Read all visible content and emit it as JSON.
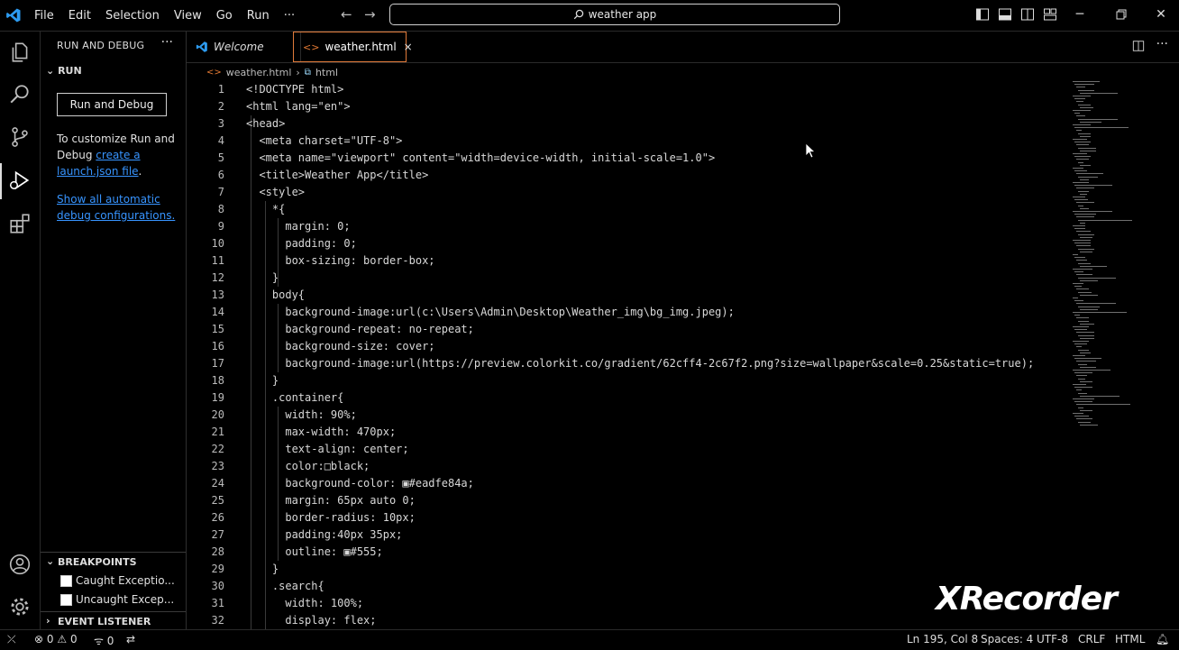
{
  "titlebar": {
    "menu": [
      "File",
      "Edit",
      "Selection",
      "View",
      "Go",
      "Run",
      "···"
    ],
    "search_text": "weather app"
  },
  "sidebar": {
    "title": "RUN AND DEBUG",
    "more": "···",
    "section_run": "RUN",
    "run_button": "Run and Debug",
    "customize_text_1": "To customize Run and Debug",
    "customize_link": "create a launch.json file",
    "customize_text_2": ".",
    "show_all_link": "Show all automatic debug configurations.",
    "breakpoints_header": "BREAKPOINTS",
    "breakpoints": [
      "Caught Exceptio...",
      "Uncaught Excep..."
    ],
    "event_listener_header": "EVENT LISTENER BREAKP..."
  },
  "tabs": [
    {
      "label": "Welcome",
      "active": false
    },
    {
      "label": "weather.html",
      "active": true,
      "close": "×"
    }
  ],
  "breadcrumb": {
    "file": "weather.html",
    "element": "html"
  },
  "code": [
    {
      "n": "1",
      "t": "<!DOCTYPE html>"
    },
    {
      "n": "2",
      "t": "<html lang=\"en\">"
    },
    {
      "n": "3",
      "t": "<head>"
    },
    {
      "n": "4",
      "t": "  <meta charset=\"UTF-8\">"
    },
    {
      "n": "5",
      "t": "  <meta name=\"viewport\" content=\"width=device-width, initial-scale=1.0\">"
    },
    {
      "n": "6",
      "t": "  <title>Weather App</title>"
    },
    {
      "n": "7",
      "t": "  <style>"
    },
    {
      "n": "8",
      "t": "    *{"
    },
    {
      "n": "9",
      "t": "      margin: 0;"
    },
    {
      "n": "10",
      "t": "      padding: 0;"
    },
    {
      "n": "11",
      "t": "      box-sizing: border-box;"
    },
    {
      "n": "12",
      "t": "    }"
    },
    {
      "n": "13",
      "t": "    body{"
    },
    {
      "n": "14",
      "t": "      background-image:url(c:\\Users\\Admin\\Desktop\\Weather_img\\bg_img.jpeg);"
    },
    {
      "n": "15",
      "t": "      background-repeat: no-repeat;"
    },
    {
      "n": "16",
      "t": "      background-size: cover;"
    },
    {
      "n": "17",
      "t": "      background-image:url(https://preview.colorkit.co/gradient/62cff4-2c67f2.png?size=wallpaper&scale=0.25&static=true);"
    },
    {
      "n": "18",
      "t": "    }"
    },
    {
      "n": "19",
      "t": "    .container{"
    },
    {
      "n": "20",
      "t": "      width: 90%;"
    },
    {
      "n": "21",
      "t": "      max-width: 470px;"
    },
    {
      "n": "22",
      "t": "      text-align: center;"
    },
    {
      "n": "23",
      "t": "      color:□black;"
    },
    {
      "n": "24",
      "t": "      background-color: ▣#eadfe84a;"
    },
    {
      "n": "25",
      "t": "      margin: 65px auto 0;"
    },
    {
      "n": "26",
      "t": "      border-radius: 10px;"
    },
    {
      "n": "27",
      "t": "      padding:40px 35px;"
    },
    {
      "n": "28",
      "t": "      outline: ▣#555;"
    },
    {
      "n": "29",
      "t": "    }"
    },
    {
      "n": "30",
      "t": "    .search{"
    },
    {
      "n": "31",
      "t": "      width: 100%;"
    },
    {
      "n": "32",
      "t": "      display: flex;"
    }
  ],
  "watermark": "XRecorder",
  "statusbar": {
    "errors": "0",
    "warnings": "0",
    "ports": "0",
    "position": "Ln 195, Col 8",
    "spaces": "Spaces: 4",
    "encoding": "UTF-8",
    "eol": "CRLF",
    "language": "HTML"
  },
  "colors": {
    "accent_tab": "#e07a3a",
    "link": "#3794ff",
    "tag": "#4a90d9"
  }
}
